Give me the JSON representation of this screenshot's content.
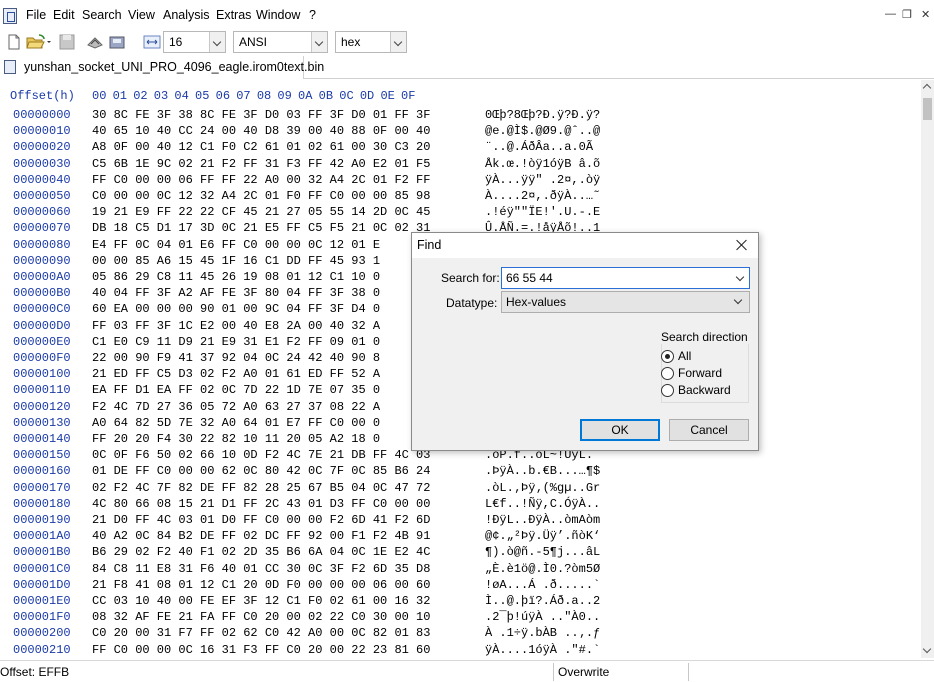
{
  "menubar": {
    "items": [
      "File",
      "Edit",
      "Search",
      "View",
      "Analysis",
      "Extras",
      "Window",
      "?"
    ]
  },
  "toolbar": {
    "bytes_per_row": "16",
    "charset": "ANSI",
    "offset_base": "hex",
    "icons": [
      "new-file-icon",
      "open-file-icon",
      "save-icon",
      "view-icon",
      "disk-icon",
      "bytes-per-row-icon"
    ]
  },
  "tabs": [
    {
      "label": "yunshan_socket_UNI_PRO_4096_eagle.irom0text.bin"
    }
  ],
  "editor": {
    "header_offset": "Offset(h)",
    "header_bytes": "00 01 02 03 04 05 06 07 08 09 0A 0B 0C 0D 0E 0F",
    "rows": [
      {
        "addr": "00000000",
        "bytes": "30 8C FE 3F 38 8C FE 3F D0 03 FF 3F D0 01 FF 3F",
        "text": "0Œþ?8Œþ?Ð.ÿ?Ð.ÿ?"
      },
      {
        "addr": "00000010",
        "bytes": "40 65 10 40 CC 24 00 40 D8 39 00 40 88 0F 00 40",
        "text": "@e.@Ì$.@Ø9.@ˆ..@"
      },
      {
        "addr": "00000020",
        "bytes": "A8 0F 00 40 12 C1 F0 C2 61 01 02 61 00 30 C3 20",
        "text": "¨..@.ÁðÂa..a.0Ã "
      },
      {
        "addr": "00000030",
        "bytes": "C5 6B 1E 9C 02 21 F2 FF 31 F3 FF 42 A0 E2 01 F5",
        "text": "Åk.œ.!òÿ1óÿB â.õ"
      },
      {
        "addr": "00000040",
        "bytes": "FF C0 00 00 06 FF FF 22 A0 00 32 A4 2C 01 F2 FF",
        "text": "ÿÀ...ÿÿ\" .2¤,.òÿ"
      },
      {
        "addr": "00000050",
        "bytes": "C0 00 00 0C 12 32 A4 2C 01 F0 FF C0 00 00 85 98",
        "text": "À....2¤,.ðÿÀ..…˜"
      },
      {
        "addr": "00000060",
        "bytes": "19 21 E9 FF 22 22 CF 45 21 27 05 55 14 2D 0C 45",
        "text": ".!éÿ\"\"ÏE!'.U.-.E"
      },
      {
        "addr": "00000070",
        "bytes": "DB 18 C5 D1 17 3D 0C 21 E5 FF C5 F5 21 0C 02 31",
        "text": "Û.ÅÑ.=.!åÿÅõ!..1"
      },
      {
        "addr": "00000080",
        "bytes": "E4 FF 0C 04 01 E6 FF C0 00 00 0C 12 01 E",
        "text": ""
      },
      {
        "addr": "00000090",
        "bytes": "00 00 85 A6 15 45 1F 16 C1 DD FF 45 93 1",
        "text": ""
      },
      {
        "addr": "000000A0",
        "bytes": "05 86 29 C8 11 45 26 19 08 01 12 C1 10 0",
        "text": ""
      },
      {
        "addr": "000000B0",
        "bytes": "40 04 FF 3F A2 AF FE 3F 80 04 FF 3F 38 0",
        "text": ""
      },
      {
        "addr": "000000C0",
        "bytes": "60 EA 00 00 00 90 01 00 9C 04 FF 3F D4 0",
        "text": ""
      },
      {
        "addr": "000000D0",
        "bytes": "FF 03 FF 3F 1C E2 00 40 E8 2A 00 40 32 A",
        "text": ""
      },
      {
        "addr": "000000E0",
        "bytes": "C1 E0 C9 11 D9 21 E9 31 E1 F2 FF 09 01 0",
        "text": ""
      },
      {
        "addr": "000000F0",
        "bytes": "22 00 90 F9 41 37 92 04 0C 24 42 40 90 8",
        "text": ""
      },
      {
        "addr": "00000100",
        "bytes": "21 ED FF C5 D3 02 F2 A0 01 61 ED FF 52 A",
        "text": ""
      },
      {
        "addr": "00000110",
        "bytes": "EA FF D1 EA FF 02 0C 7D 22 1D 7E 07 35 0",
        "text": ""
      },
      {
        "addr": "00000120",
        "bytes": "F2 4C 7D 27 36 05 72 A0 63 27 37 08 22 A",
        "text": ""
      },
      {
        "addr": "00000130",
        "bytes": "A0 64 82 5D 7E 32 A0 64 01 E7 FF C0 00 0",
        "text": ""
      },
      {
        "addr": "00000140",
        "bytes": "FF 20 20 F4 30 22 82 10 11 20 05 A2 18 0",
        "text": ""
      },
      {
        "addr": "00000150",
        "bytes": "0C 0F F6 50 02 66 10 0D F2 4C 7E 21 DB FF 4C 03",
        "text": ".öP.f..òL~!ÛÿL."
      },
      {
        "addr": "00000160",
        "bytes": "01 DE FF C0 00 00 62 0C 80 42 0C 7F 0C 85 B6 24",
        "text": ".ÞÿÀ..b.€B...…¶$"
      },
      {
        "addr": "00000170",
        "bytes": "02 F2 4C 7F 82 DE FF 82 28 25 67 B5 04 0C 47 72",
        "text": ".òL.‚Þÿ‚(%gµ..Gr"
      },
      {
        "addr": "00000180",
        "bytes": "4C 80 66 08 15 21 D1 FF 2C 43 01 D3 FF C0 00 00",
        "text": "L€f..!Ñÿ,C.ÓÿÀ.."
      },
      {
        "addr": "00000190",
        "bytes": "21 D0 FF 4C 03 01 D0 FF C0 00 00 F2 6D 41 F2 6D",
        "text": "!ÐÿL..ÐÿÀ..òmAòm"
      },
      {
        "addr": "000001A0",
        "bytes": "40 A2 0C 84 B2 DE FF 02 DC FF 92 00 F1 F2 4B 91",
        "text": "@¢.„²Þÿ.Üÿ’.ñòK‘"
      },
      {
        "addr": "000001B0",
        "bytes": "B6 29 02 F2 40 F1 02 2D 35 B6 6A 04 0C 1E E2 4C",
        "text": "¶).ò@ñ.-5¶j...âL"
      },
      {
        "addr": "000001C0",
        "bytes": "84 C8 11 E8 31 F6 40 01 CC 30 0C 3F F2 6D 35 D8",
        "text": "„È.è1ö@.Ì0.?òm5Ø"
      },
      {
        "addr": "000001D0",
        "bytes": "21 F8 41 08 01 12 C1 20 0D F0 00 00 00 06 00 60",
        "text": "!øA...Á .ð.....`"
      },
      {
        "addr": "000001E0",
        "bytes": "CC 03 10 40 00 FE EF 3F 12 C1 F0 02 61 00 16 32",
        "text": "Ì..@.þï?.Áð.a..2"
      },
      {
        "addr": "000001F0",
        "bytes": "08 32 AF FE 21 FA FF C0 20 00 02 22 C0 30 00 10",
        "text": ".2¯þ!úÿÀ ..\"À0.."
      },
      {
        "addr": "00000200",
        "bytes": "C0 20 00 31 F7 FF 02 62 C0 42 A0 00 0C 82 01 83",
        "text": "À .1÷ÿ.bÀB ..‚.ƒ"
      },
      {
        "addr": "00000210",
        "bytes": "FF C0 00 00 0C 16 31 F3 FF C0 20 00 22 23 81 60",
        "text": "ÿÀ....1óÿÀ .\"#.`"
      }
    ]
  },
  "statusbar": {
    "offset": "Offset: EFFB",
    "mode": "Overwrite"
  },
  "find_dialog": {
    "title": "Find",
    "search_label": "Search for:",
    "search_value": "66 55 44",
    "datatype_label": "Datatype:",
    "datatype_value": "Hex-values",
    "direction_title": "Search direction",
    "directions": [
      "All",
      "Forward",
      "Backward"
    ],
    "selected_direction": "All",
    "ok_label": "OK",
    "cancel_label": "Cancel"
  },
  "colors": {
    "offset_blue": "#1a3aa8",
    "dialog_bg": "#f0f0f0",
    "focus_blue": "#0078d7"
  }
}
